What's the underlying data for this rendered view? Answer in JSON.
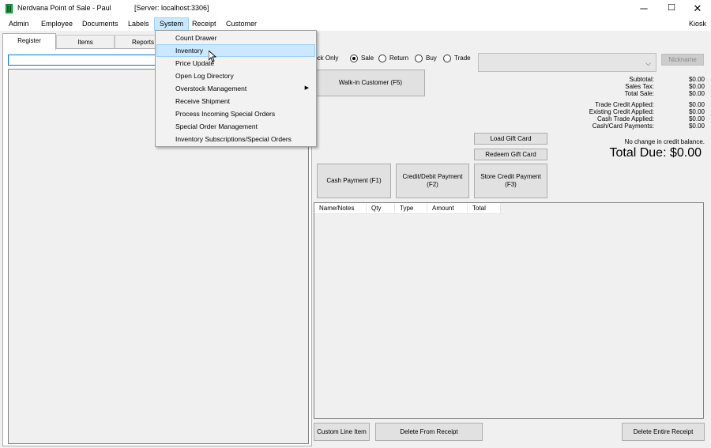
{
  "window": {
    "title": "Nerdvana Point of Sale - Paul",
    "server": "[Server: localhost:3306]",
    "minimize": "─",
    "maximize": "☐",
    "close": "✕"
  },
  "menubar": {
    "items": [
      "Admin",
      "Employee",
      "Documents",
      "Labels",
      "System",
      "Receipt",
      "Customer"
    ],
    "right": "Kiosk"
  },
  "system_menu": {
    "items": [
      {
        "label": "Count Drawer"
      },
      {
        "label": "Inventory",
        "highlighted": true
      },
      {
        "label": "Price Update"
      },
      {
        "label": "Open Log Directory"
      },
      {
        "label": "Overstock Management",
        "submenu": true
      },
      {
        "label": "Receive Shipment"
      },
      {
        "label": "Process Incoming Special Orders"
      },
      {
        "label": "Special Order Management"
      },
      {
        "label": "Inventory Subscriptions/Special Orders"
      }
    ],
    "submenu_arrow": "▶"
  },
  "tabs": [
    "Register",
    "Items",
    "Reports"
  ],
  "transaction": {
    "stock_only_label": "tock Only",
    "modes": [
      {
        "label": "Sale",
        "checked": true
      },
      {
        "label": "Return",
        "checked": false
      },
      {
        "label": "Buy",
        "checked": false
      },
      {
        "label": "Trade",
        "checked": false
      }
    ],
    "nickname_button": "Nickname",
    "combo_arrow": "⌵",
    "walkin_button": "Walk-in Customer (F5)"
  },
  "totals": {
    "rows": [
      {
        "label": "Subtotal:",
        "value": "$0.00"
      },
      {
        "label": "Sales Tax:",
        "value": "$0.00"
      },
      {
        "label": "Total Sale:",
        "value": "$0.00"
      },
      {
        "label": "Trade Credit Applied:",
        "value": "$0.00"
      },
      {
        "label": "Existing Credit Applied:",
        "value": "$0.00"
      },
      {
        "label": "Cash Trade Applied:",
        "value": "$0.00"
      },
      {
        "label": "Cash/Card Payments:",
        "value": "$0.00"
      }
    ],
    "credit_note": "No change in credit balance.",
    "total_due": "Total Due: $0.00"
  },
  "gift": {
    "load": "Load Gift Card",
    "redeem": "Redeem Gift Card"
  },
  "payments": {
    "cash": "Cash Payment (F1)",
    "card_line1": "Credit/Debit Payment",
    "card_line2": "(F2)",
    "store_line1": "Store Credit Payment",
    "store_line2": "(F3)"
  },
  "receipt": {
    "columns": [
      "Name/Notes",
      "Qty",
      "Type",
      "Amount",
      "Total"
    ]
  },
  "bottom_buttons": {
    "custom_line": "Custom Line Item",
    "delete_from": "Delete From Receipt",
    "delete_entire": "Delete Entire Receipt"
  }
}
